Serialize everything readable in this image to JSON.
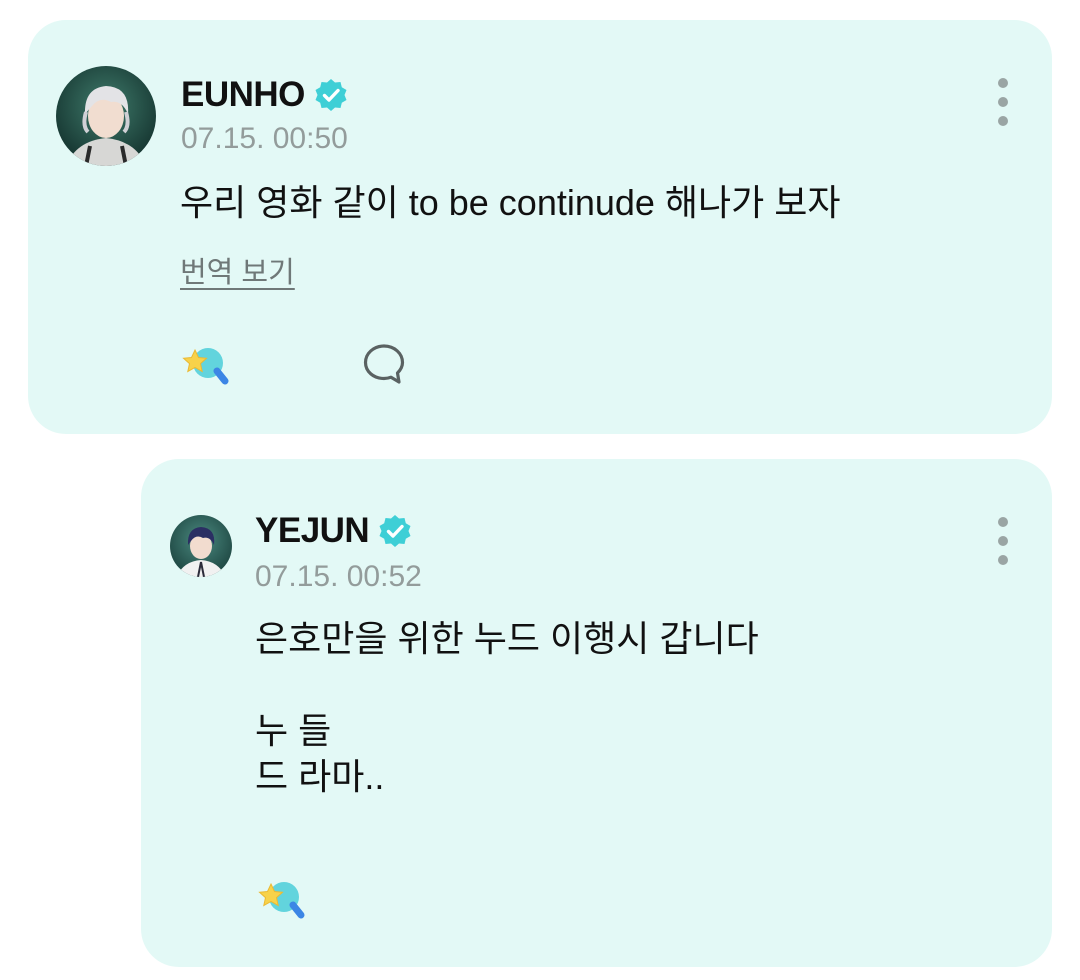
{
  "posts": [
    {
      "author": "EUNHO",
      "timestamp": "07.15. 00:50",
      "content": "우리 영화 같이 to be continude 해나가 보자",
      "translate_label": "번역 보기",
      "verified": true,
      "icons": {
        "verified": "verified-badge-icon",
        "more": "more-vertical-icon",
        "reaction": "star-wand-icon",
        "comment": "comment-bubble-icon"
      }
    },
    {
      "author": "YEJUN",
      "timestamp": "07.15. 00:52",
      "content": "은호만을 위한 누드 이행시 갑니다\n\n누 들\n드 라마..",
      "verified": true,
      "icons": {
        "verified": "verified-badge-icon",
        "more": "more-vertical-icon",
        "reaction": "star-wand-icon"
      }
    }
  ],
  "colors": {
    "card_background": "#e3f9f6",
    "verified": "#3ecfd6",
    "timestamp": "#939c9b",
    "text": "#111111"
  }
}
